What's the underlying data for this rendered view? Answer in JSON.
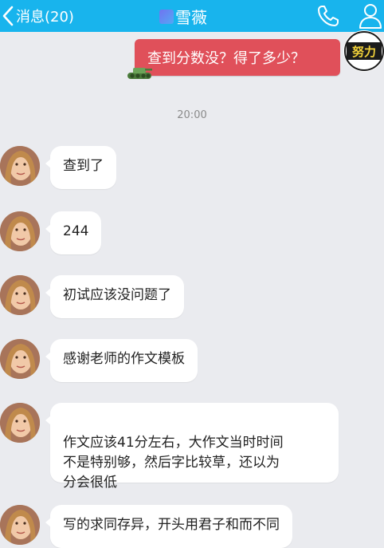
{
  "header": {
    "back_label": "消息(20)",
    "contact_name": "雪薇",
    "colors": {
      "bar": "#18b4ed",
      "text": "#ffffff"
    },
    "icons": [
      "chevron-left-icon",
      "phone-icon",
      "person-icon"
    ]
  },
  "outgoing": {
    "text": "查到分数没？得了多少？",
    "bubble_color": "#e0505a",
    "badge_text": "努力"
  },
  "timestamp": "20:00",
  "messages": [
    {
      "text": "查到了"
    },
    {
      "text": "244"
    },
    {
      "text": "初试应该没问题了"
    },
    {
      "text": "感谢老师的作文模板"
    },
    {
      "text": "作文应该41分左右，大作文当时时间\n不是特别够，然后字比较草，还以为\n分会很低"
    },
    {
      "text": "写的求同存异，开头用君子和而不同"
    }
  ]
}
